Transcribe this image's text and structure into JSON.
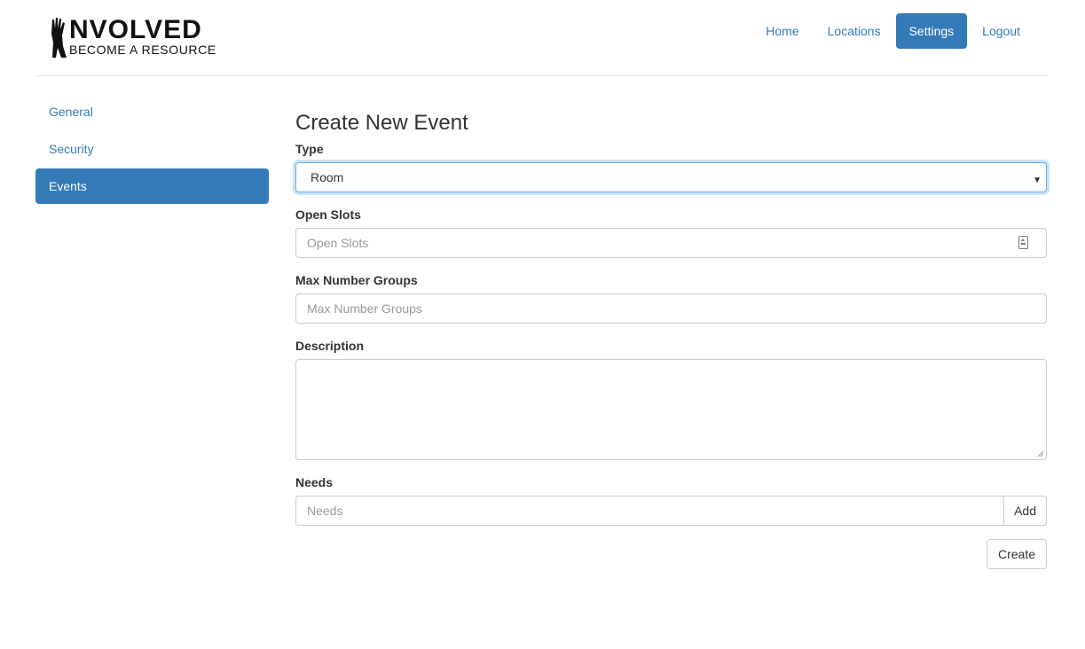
{
  "brand": {
    "word": "NVOLVED",
    "tagline": "Become a Resource"
  },
  "nav": {
    "items": [
      {
        "label": "Home"
      },
      {
        "label": "Locations"
      },
      {
        "label": "Settings"
      },
      {
        "label": "Logout"
      }
    ],
    "active": "Settings"
  },
  "sidebar": {
    "items": [
      {
        "label": "General"
      },
      {
        "label": "Security"
      },
      {
        "label": "Events"
      }
    ],
    "active": "Events"
  },
  "form": {
    "title": "Create New Event",
    "type": {
      "label": "Type",
      "value": "Room"
    },
    "open_slots": {
      "label": "Open Slots",
      "placeholder": "Open Slots"
    },
    "max_groups": {
      "label": "Max Number Groups",
      "placeholder": "Max Number Groups"
    },
    "description": {
      "label": "Description",
      "value": ""
    },
    "needs": {
      "label": "Needs",
      "placeholder": "Needs",
      "add_label": "Add"
    },
    "create_label": "Create"
  },
  "colors": {
    "accent": "#337ab7",
    "focus": "#66afe9",
    "border": "#cccccc"
  }
}
